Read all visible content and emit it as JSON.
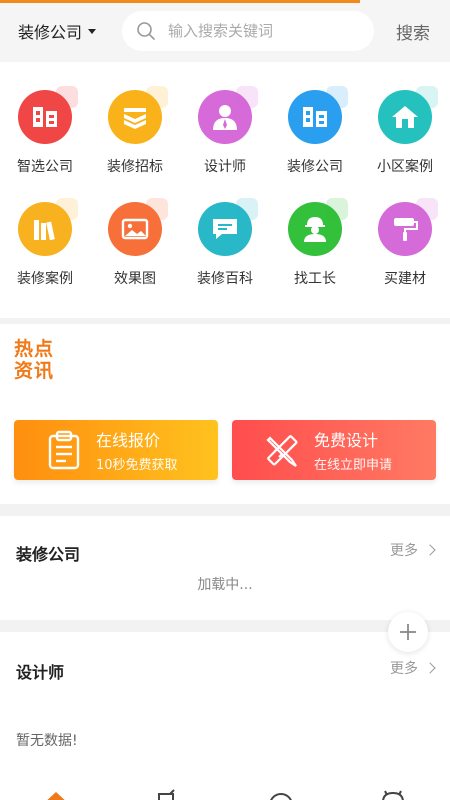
{
  "header": {
    "city": "装修公司",
    "search_placeholder": "输入搜索关键词",
    "search_button": "搜索"
  },
  "progress": 0.8,
  "grid": [
    {
      "label": "智选公司",
      "icon": "building-icon",
      "color": "#f04646"
    },
    {
      "label": "装修招标",
      "icon": "layers-icon",
      "color": "#f9b21a"
    },
    {
      "label": "设计师",
      "icon": "person-icon",
      "color": "#d66ad8"
    },
    {
      "label": "装修公司",
      "icon": "building-icon",
      "color": "#2a9ff0"
    },
    {
      "label": "小区案例",
      "icon": "house-icon",
      "color": "#25c1bf"
    },
    {
      "label": "装修案例",
      "icon": "books-icon",
      "color": "#f8b21f"
    },
    {
      "label": "效果图",
      "icon": "image-icon",
      "color": "#f7703a"
    },
    {
      "label": "装修百科",
      "icon": "chat-icon",
      "color": "#28b8c8"
    },
    {
      "label": "找工长",
      "icon": "worker-icon",
      "color": "#33c03b"
    },
    {
      "label": "买建材",
      "icon": "paint-roller-icon",
      "color": "#d56bd8"
    }
  ],
  "news": {
    "logo_line1": "热点",
    "logo_line2": "资讯"
  },
  "banners": [
    {
      "title": "在线报价",
      "subtitle": "10秒免费获取",
      "icon": "clipboard-icon"
    },
    {
      "title": "免费设计",
      "subtitle": "在线立即申请",
      "icon": "ruler-pencil-icon"
    }
  ],
  "company": {
    "title": "装修公司",
    "more": "更多",
    "loading": "加载中..."
  },
  "designer": {
    "title": "设计师",
    "more": "更多",
    "empty": "暂无数据!"
  },
  "colors": {
    "accent": "#f08a1c",
    "banner1": "#ff8e0f",
    "banner2": "#ff4d4d"
  }
}
